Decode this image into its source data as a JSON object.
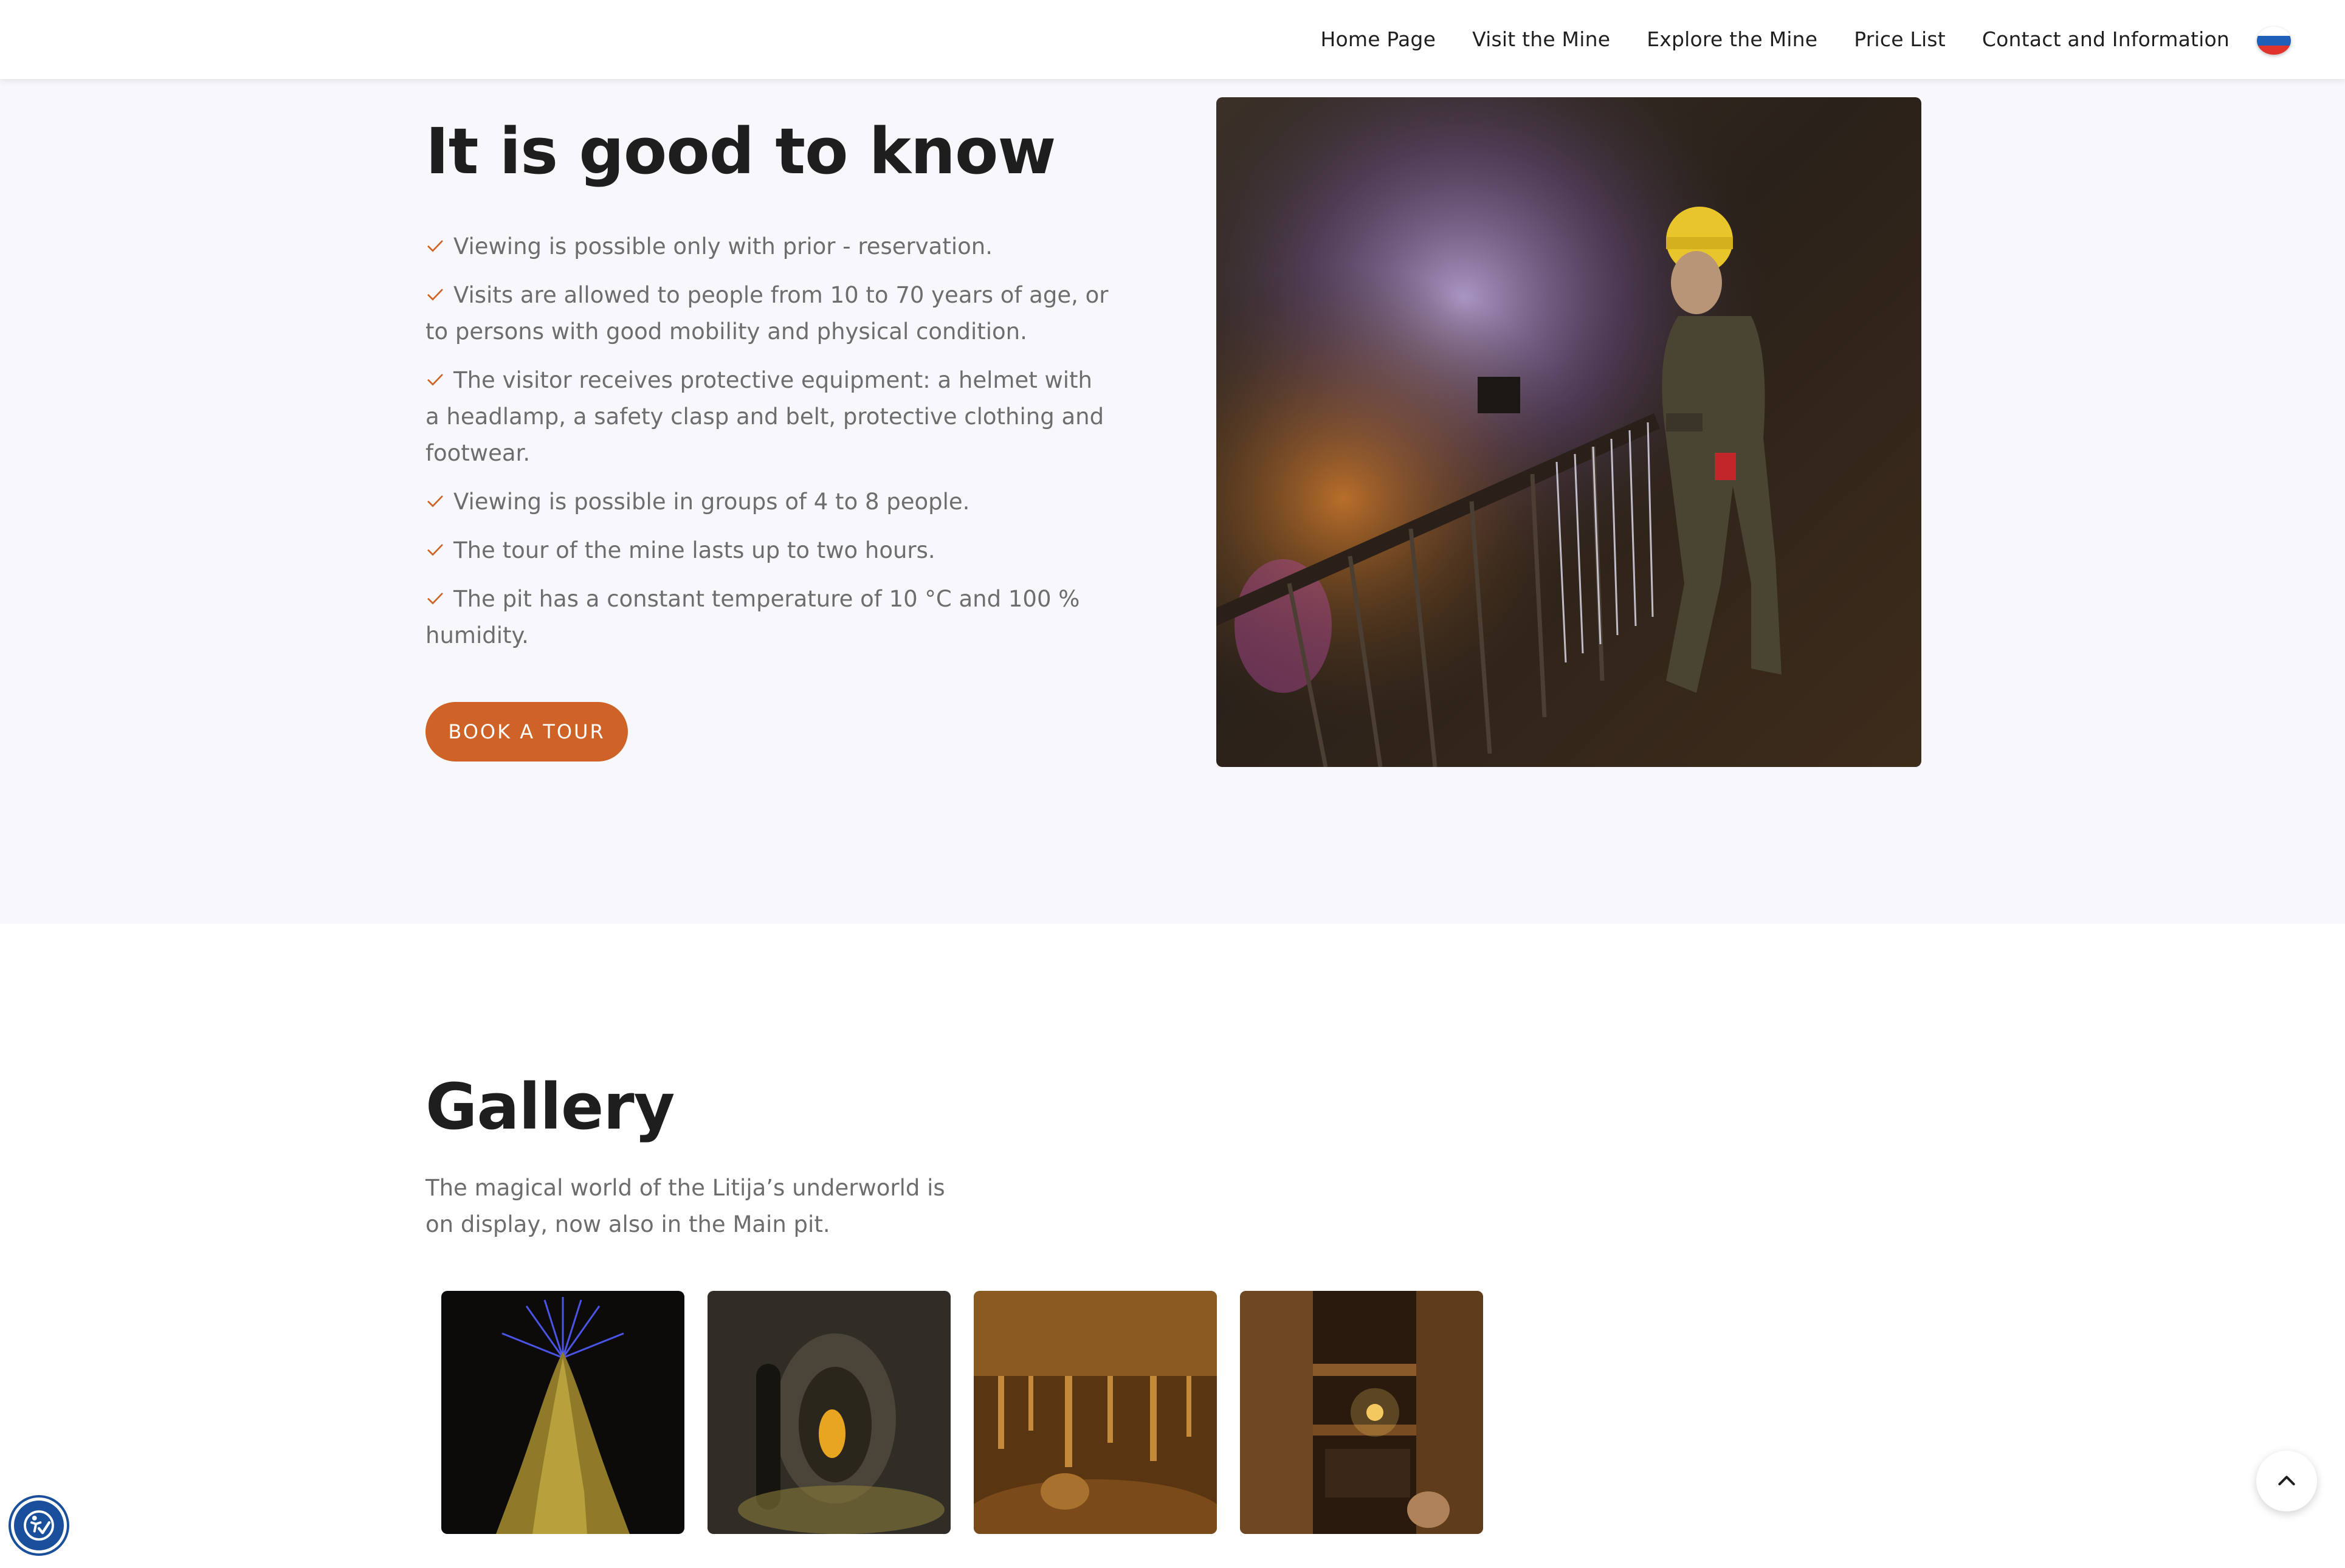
{
  "nav": {
    "items": [
      {
        "label": "Home Page"
      },
      {
        "label": "Visit the Mine"
      },
      {
        "label": "Explore the Mine"
      },
      {
        "label": "Price List"
      },
      {
        "label": "Contact and Information"
      }
    ],
    "language_flag": "slovenian-flag-icon"
  },
  "info": {
    "title": "It is good to know",
    "items": [
      "Viewing is possible only with prior - reservation.",
      "Visits are allowed to people from 10 to 70 years of age, or to persons with good mobility and physical condition.",
      "The visitor receives protective equipment: a helmet with a headlamp, a safety clasp and belt, protective clothing and footwear.",
      "Viewing is possible in groups of 4 to 8 people.",
      "The tour of the mine lasts up to two hours.",
      "The pit has a constant temperature of 10 °C and 100 % humidity."
    ],
    "book_label": "BOOK A TOUR",
    "check_icon": "check-icon"
  },
  "gallery": {
    "title": "Gallery",
    "subtitle": "The magical world of the Litija’s underworld is on display, now also in the Main pit."
  },
  "colors": {
    "accent": "#cf6226",
    "section_bg": "#f8f8fc",
    "heading": "#1e1e1e",
    "body_text": "#6d6d6d",
    "a11y_badge": "#1a4f9c"
  },
  "widgets": {
    "scroll_top_icon": "chevron-up-icon",
    "accessibility_icon": "accessibility-icon"
  }
}
